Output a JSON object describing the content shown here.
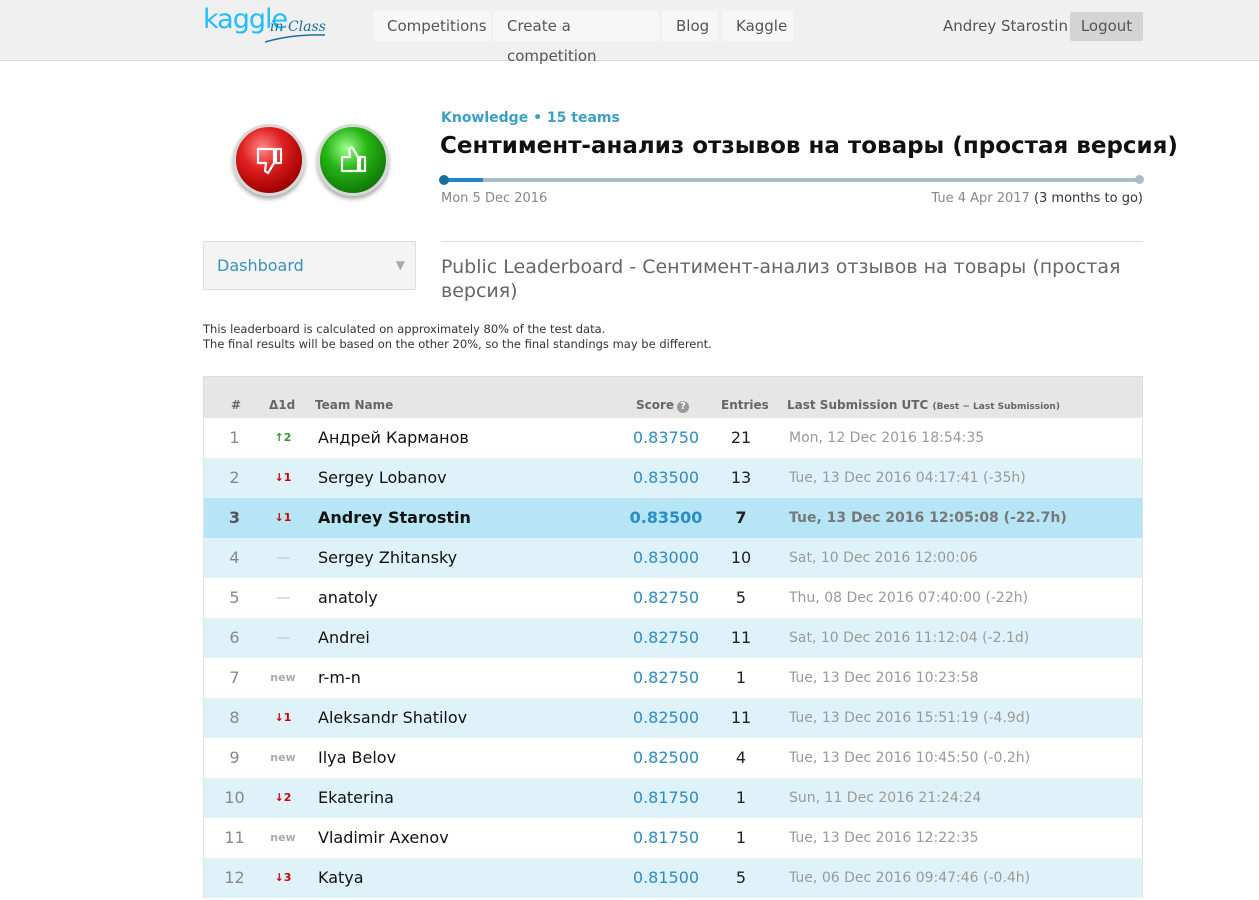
{
  "header": {
    "logo_main": "kaggle",
    "logo_sub": "in Class",
    "nav": [
      "Competitions",
      "Create a competition",
      "Blog",
      "Kaggle"
    ],
    "user": "Andrey Starostin",
    "logout": "Logout"
  },
  "competition": {
    "meta": "Knowledge • 15 teams",
    "title": "Сентимент-анализ отзывов на товары (простая версия)",
    "start_date": "Mon 5 Dec 2016",
    "end_date": "Tue 4 Apr 2017",
    "remaining": "(3 months to go)",
    "progress_fraction": 0.06
  },
  "sidebar": {
    "dashboard_label": "Dashboard",
    "dashboard_arrow": "▼"
  },
  "leaderboard": {
    "title": "Public Leaderboard - Сентимент-анализ отзывов на товары (простая версия)",
    "notice_line1": "This leaderboard is calculated on approximately 80% of the test data.",
    "notice_line2": "The final results will be based on the other 20%, so the final standings may be different.",
    "columns": {
      "rank": "#",
      "delta": "Δ1d",
      "team": "Team Name",
      "score": "Score",
      "entries": "Entries",
      "last": "Last Submission UTC",
      "last_note": "(Best − Last Submission)"
    },
    "rows": [
      {
        "rank": "1",
        "delta": "↑2",
        "delta_type": "up",
        "team": "Андрей Карманов",
        "score": "0.83750",
        "entries": "21",
        "last": "Mon, 12 Dec 2016 18:54:35"
      },
      {
        "rank": "2",
        "delta": "↓1",
        "delta_type": "down",
        "team": "Sergey Lobanov",
        "score": "0.83500",
        "entries": "13",
        "last": "Tue, 13 Dec 2016 04:17:41 (-35h)"
      },
      {
        "rank": "3",
        "delta": "↓1",
        "delta_type": "down",
        "team": "Andrey Starostin",
        "score": "0.83500",
        "entries": "7",
        "last": "Tue, 13 Dec 2016 12:05:08 (-22.7h)",
        "current_user": true
      },
      {
        "rank": "4",
        "delta": "—",
        "delta_type": "same",
        "team": "Sergey Zhitansky",
        "score": "0.83000",
        "entries": "10",
        "last": "Sat, 10 Dec 2016 12:00:06"
      },
      {
        "rank": "5",
        "delta": "—",
        "delta_type": "same",
        "team": "anatoly",
        "score": "0.82750",
        "entries": "5",
        "last": "Thu, 08 Dec 2016 07:40:00 (-22h)"
      },
      {
        "rank": "6",
        "delta": "—",
        "delta_type": "same",
        "team": "Andrei",
        "score": "0.82750",
        "entries": "11",
        "last": "Sat, 10 Dec 2016 11:12:04 (-2.1d)"
      },
      {
        "rank": "7",
        "delta": "new",
        "delta_type": "new",
        "team": "r-m-n",
        "score": "0.82750",
        "entries": "1",
        "last": "Tue, 13 Dec 2016 10:23:58"
      },
      {
        "rank": "8",
        "delta": "↓1",
        "delta_type": "down",
        "team": "Aleksandr Shatilov",
        "score": "0.82500",
        "entries": "11",
        "last": "Tue, 13 Dec 2016 15:51:19 (-4.9d)"
      },
      {
        "rank": "9",
        "delta": "new",
        "delta_type": "new",
        "team": "Ilya Belov",
        "score": "0.82500",
        "entries": "4",
        "last": "Tue, 13 Dec 2016 10:45:50 (-0.2h)"
      },
      {
        "rank": "10",
        "delta": "↓2",
        "delta_type": "down",
        "team": "Ekaterina",
        "score": "0.81750",
        "entries": "1",
        "last": "Sun, 11 Dec 2016 21:24:24"
      },
      {
        "rank": "11",
        "delta": "new",
        "delta_type": "new",
        "team": "Vladimir Axenov",
        "score": "0.81750",
        "entries": "1",
        "last": "Tue, 13 Dec 2016 12:22:35"
      },
      {
        "rank": "12",
        "delta": "↓3",
        "delta_type": "down",
        "team": "Katya",
        "score": "0.81500",
        "entries": "5",
        "last": "Tue, 06 Dec 2016 09:47:46 (-0.4h)"
      }
    ]
  }
}
